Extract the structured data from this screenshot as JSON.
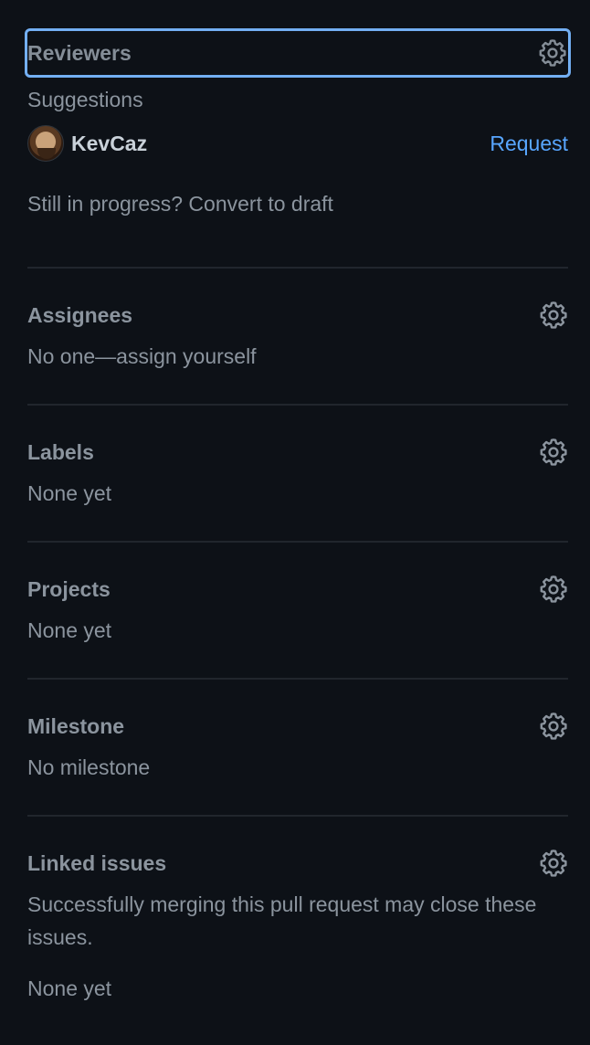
{
  "reviewers": {
    "title": "Reviewers",
    "suggestions_label": "Suggestions",
    "suggested": [
      {
        "name": "KevCaz",
        "action": "Request"
      }
    ],
    "draft_prompt": "Still in progress?",
    "draft_link": "Convert to draft"
  },
  "assignees": {
    "title": "Assignees",
    "value": "No one—assign yourself"
  },
  "labels": {
    "title": "Labels",
    "value": "None yet"
  },
  "projects": {
    "title": "Projects",
    "value": "None yet"
  },
  "milestone": {
    "title": "Milestone",
    "value": "No milestone"
  },
  "linked_issues": {
    "title": "Linked issues",
    "description": "Successfully merging this pull request may close these issues.",
    "value": "None yet"
  },
  "icons": {
    "gear": "gear-icon"
  },
  "colors": {
    "background": "#0d1117",
    "text_muted": "#8b949e",
    "text_primary": "#c9d1d9",
    "link": "#58a6ff",
    "focus_border": "#79b8ff",
    "divider": "#21262d"
  }
}
